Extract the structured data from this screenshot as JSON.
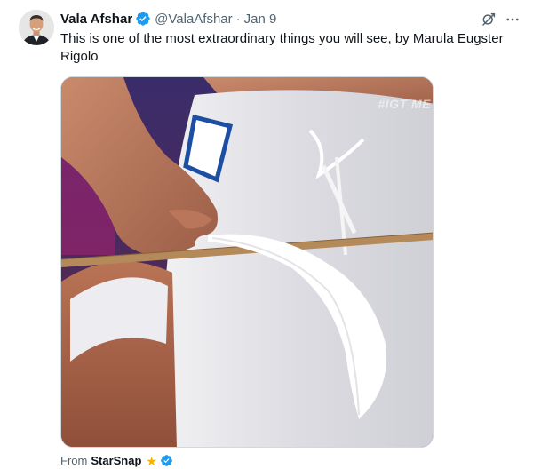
{
  "author": {
    "display_name": "Vala Afshar",
    "handle": "@ValaAfshar",
    "separator": "·",
    "date": "Jan 9",
    "verified_color": "#1d9bf0"
  },
  "tweet": {
    "text": "This is one of the most extraordinary things you will see, by Marula Eugster Rigolo"
  },
  "media": {
    "watermark": "#IGT ME"
  },
  "source": {
    "prefix": "From",
    "name": "StarSnap",
    "star_icon": "★",
    "star_color": "#f4b400"
  },
  "icons": {
    "grok": "grok-icon",
    "more": "more-icon",
    "verified": "verified-badge-icon"
  },
  "colors": {
    "text_primary": "#0f1419",
    "text_secondary": "#536471",
    "accent": "#1d9bf0"
  }
}
